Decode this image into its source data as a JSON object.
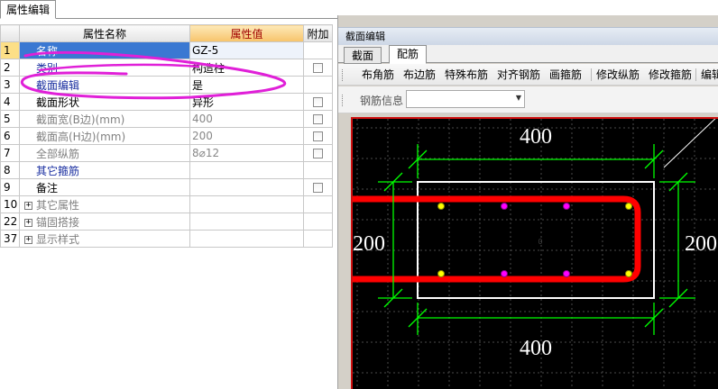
{
  "left_panel": {
    "tab_label": "属性编辑",
    "headers": {
      "name": "属性名称",
      "value": "属性值",
      "extra": "附加"
    },
    "rows": [
      {
        "num": "1",
        "name": "名称",
        "value": "GZ-5",
        "checkbox": false
      },
      {
        "num": "2",
        "name": "类别",
        "value": "构造柱",
        "checkbox": true
      },
      {
        "num": "3",
        "name": "截面编辑",
        "value": "是",
        "checkbox": false
      },
      {
        "num": "4",
        "name": "截面形状",
        "value": "异形",
        "checkbox": true
      },
      {
        "num": "5",
        "name": "截面宽(B边)(mm)",
        "value": "400",
        "checkbox": true
      },
      {
        "num": "6",
        "name": "截面高(H边)(mm)",
        "value": "200",
        "checkbox": true
      },
      {
        "num": "7",
        "name": "全部纵筋",
        "value": "8⌀12",
        "checkbox": true
      },
      {
        "num": "8",
        "name": "其它箍筋",
        "value": "",
        "checkbox": false
      },
      {
        "num": "9",
        "name": "备注",
        "value": "",
        "checkbox": true
      },
      {
        "num": "10",
        "name": "其它属性",
        "value": "",
        "checkbox": false
      },
      {
        "num": "22",
        "name": "锚固搭接",
        "value": "",
        "checkbox": false
      },
      {
        "num": "37",
        "name": "显示样式",
        "value": "",
        "checkbox": false
      }
    ],
    "expander_symbol": "+",
    "annotation_color": "#e020d8"
  },
  "right_panel": {
    "title": "截面编辑",
    "tabs": [
      "截面",
      "配筋"
    ],
    "active_tab": "配筋",
    "toolbar": [
      "布角筋",
      "布边筋",
      "特殊布筋",
      "对齐钢筋",
      "画箍筋",
      "修改纵筋",
      "修改箍筋",
      "编辑"
    ],
    "rebar_info_label": "钢筋信息",
    "rebar_info_value": "",
    "drawing": {
      "width_label_top": "400",
      "width_label_bottom": "400",
      "height_label_left": "200",
      "height_label_right": "200",
      "center_mark": "0",
      "colors": {
        "background": "#000000",
        "grid": "#5a5a5a",
        "outline": "#ffffff",
        "dimension": "#00ff00",
        "stirrup": "#ff0000",
        "corner_bar": "#ffff00",
        "edge_bar": "#ff00ff",
        "frame": "#d01010"
      }
    }
  }
}
